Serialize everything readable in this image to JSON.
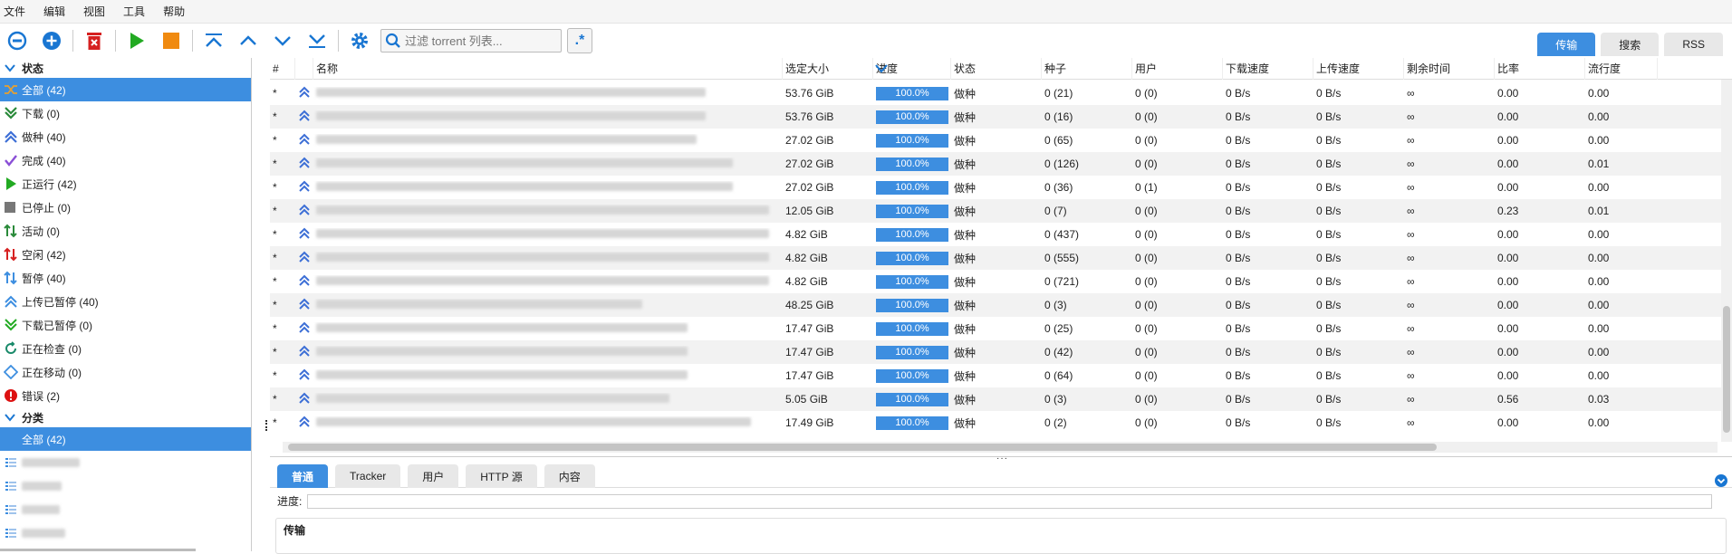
{
  "menu": [
    "文件",
    "编辑",
    "视图",
    "工具",
    "帮助"
  ],
  "search": {
    "placeholder": "过滤 torrent 列表..."
  },
  "right_tabs": [
    "传输",
    "搜索",
    "RSS"
  ],
  "sidebar": {
    "status_header": "状态",
    "status_items": [
      {
        "label": "全部 (42)",
        "icon": "shuffle-icon",
        "color": "#e8a030"
      },
      {
        "label": "下载 (0)",
        "icon": "download-icon",
        "color": "#2a8a3a"
      },
      {
        "label": "做种 (40)",
        "icon": "upload-icon",
        "color": "#3d6fd6"
      },
      {
        "label": "完成 (40)",
        "icon": "check-icon",
        "color": "#8a4fd6"
      },
      {
        "label": "正运行 (42)",
        "icon": "play-icon",
        "color": "#22aa22"
      },
      {
        "label": "已停止 (0)",
        "icon": "stop-icon",
        "color": "#777777"
      },
      {
        "label": "活动 (0)",
        "icon": "active-icon",
        "color": "#2a8a3a"
      },
      {
        "label": "空闲 (42)",
        "icon": "idle-icon",
        "color": "#d62020"
      },
      {
        "label": "暂停 (40)",
        "icon": "paused-icon",
        "color": "#3d8ee0"
      },
      {
        "label": "上传已暂停 (40)",
        "icon": "upload-paused-icon",
        "color": "#3d8ee0"
      },
      {
        "label": "下载已暂停 (0)",
        "icon": "download-paused-icon",
        "color": "#22aa22"
      },
      {
        "label": "正在检查 (0)",
        "icon": "checking-icon",
        "color": "#1a8a6a"
      },
      {
        "label": "正在移动 (0)",
        "icon": "moving-icon",
        "color": "#3d8ee0"
      },
      {
        "label": "错误 (2)",
        "icon": "error-icon",
        "color": "#dd1111"
      }
    ],
    "category_header": "分类",
    "category_all": "全部 (42)"
  },
  "table": {
    "headers": [
      "#",
      "",
      "名称",
      "选定大小",
      "进度",
      "状态",
      "种子",
      "用户",
      "下载速度",
      "上传速度",
      "剩余时间",
      "比率",
      "流行度"
    ],
    "rows": [
      [
        "*",
        "53.76 GiB",
        "100.0%",
        "做种",
        "0 (21)",
        "0 (0)",
        "0 B/s",
        "0 B/s",
        "∞",
        "0.00",
        "0.00"
      ],
      [
        "*",
        "53.76 GiB",
        "100.0%",
        "做种",
        "0 (16)",
        "0 (0)",
        "0 B/s",
        "0 B/s",
        "∞",
        "0.00",
        "0.00"
      ],
      [
        "*",
        "27.02 GiB",
        "100.0%",
        "做种",
        "0 (65)",
        "0 (0)",
        "0 B/s",
        "0 B/s",
        "∞",
        "0.00",
        "0.00"
      ],
      [
        "*",
        "27.02 GiB",
        "100.0%",
        "做种",
        "0 (126)",
        "0 (0)",
        "0 B/s",
        "0 B/s",
        "∞",
        "0.00",
        "0.01"
      ],
      [
        "*",
        "27.02 GiB",
        "100.0%",
        "做种",
        "0 (36)",
        "0 (1)",
        "0 B/s",
        "0 B/s",
        "∞",
        "0.00",
        "0.00"
      ],
      [
        "*",
        "12.05 GiB",
        "100.0%",
        "做种",
        "0 (7)",
        "0 (0)",
        "0 B/s",
        "0 B/s",
        "∞",
        "0.23",
        "0.01"
      ],
      [
        "*",
        "4.82 GiB",
        "100.0%",
        "做种",
        "0 (437)",
        "0 (0)",
        "0 B/s",
        "0 B/s",
        "∞",
        "0.00",
        "0.00"
      ],
      [
        "*",
        "4.82 GiB",
        "100.0%",
        "做种",
        "0 (555)",
        "0 (0)",
        "0 B/s",
        "0 B/s",
        "∞",
        "0.00",
        "0.00"
      ],
      [
        "*",
        "4.82 GiB",
        "100.0%",
        "做种",
        "0 (721)",
        "0 (0)",
        "0 B/s",
        "0 B/s",
        "∞",
        "0.00",
        "0.00"
      ],
      [
        "*",
        "48.25 GiB",
        "100.0%",
        "做种",
        "0 (3)",
        "0 (0)",
        "0 B/s",
        "0 B/s",
        "∞",
        "0.00",
        "0.00"
      ],
      [
        "*",
        "17.47 GiB",
        "100.0%",
        "做种",
        "0 (25)",
        "0 (0)",
        "0 B/s",
        "0 B/s",
        "∞",
        "0.00",
        "0.00"
      ],
      [
        "*",
        "17.47 GiB",
        "100.0%",
        "做种",
        "0 (42)",
        "0 (0)",
        "0 B/s",
        "0 B/s",
        "∞",
        "0.00",
        "0.00"
      ],
      [
        "*",
        "17.47 GiB",
        "100.0%",
        "做种",
        "0 (64)",
        "0 (0)",
        "0 B/s",
        "0 B/s",
        "∞",
        "0.00",
        "0.00"
      ],
      [
        "*",
        "5.05 GiB",
        "100.0%",
        "做种",
        "0 (3)",
        "0 (0)",
        "0 B/s",
        "0 B/s",
        "∞",
        "0.56",
        "0.03"
      ],
      [
        "*",
        "17.49 GiB",
        "100.0%",
        "做种",
        "0 (2)",
        "0 (0)",
        "0 B/s",
        "0 B/s",
        "∞",
        "0.00",
        "0.00"
      ]
    ]
  },
  "bottom": {
    "tabs": [
      "普通",
      "Tracker",
      "用户",
      "HTTP 源",
      "内容"
    ],
    "progress_label": "进度:",
    "section_title": "传输"
  },
  "colors": {
    "accent": "#3d8ee0"
  }
}
